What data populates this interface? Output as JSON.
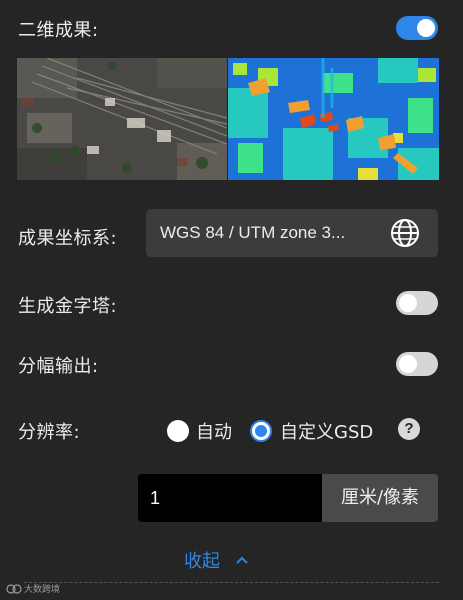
{
  "result_2d": {
    "label": "二维成果:",
    "toggle_on": true
  },
  "crs": {
    "label": "成果坐标系:",
    "value": "WGS 84 / UTM zone 3...",
    "icon": "globe-icon"
  },
  "pyramid": {
    "label": "生成金字塔:",
    "toggle_on": false
  },
  "tiling": {
    "label": "分幅输出:",
    "toggle_on": false
  },
  "resolution": {
    "label": "分辨率:",
    "options": [
      "自动",
      "自定义GSD"
    ],
    "selected": "自定义GSD",
    "help_icon": "?",
    "gsd_value": "1",
    "unit": "厘米/像素"
  },
  "collapse": {
    "label": "收起"
  },
  "watermark": {
    "text": "大数跨境"
  },
  "colors": {
    "accent": "#2f86e8",
    "background": "#252525",
    "input_bg": "#3c3c3c"
  }
}
